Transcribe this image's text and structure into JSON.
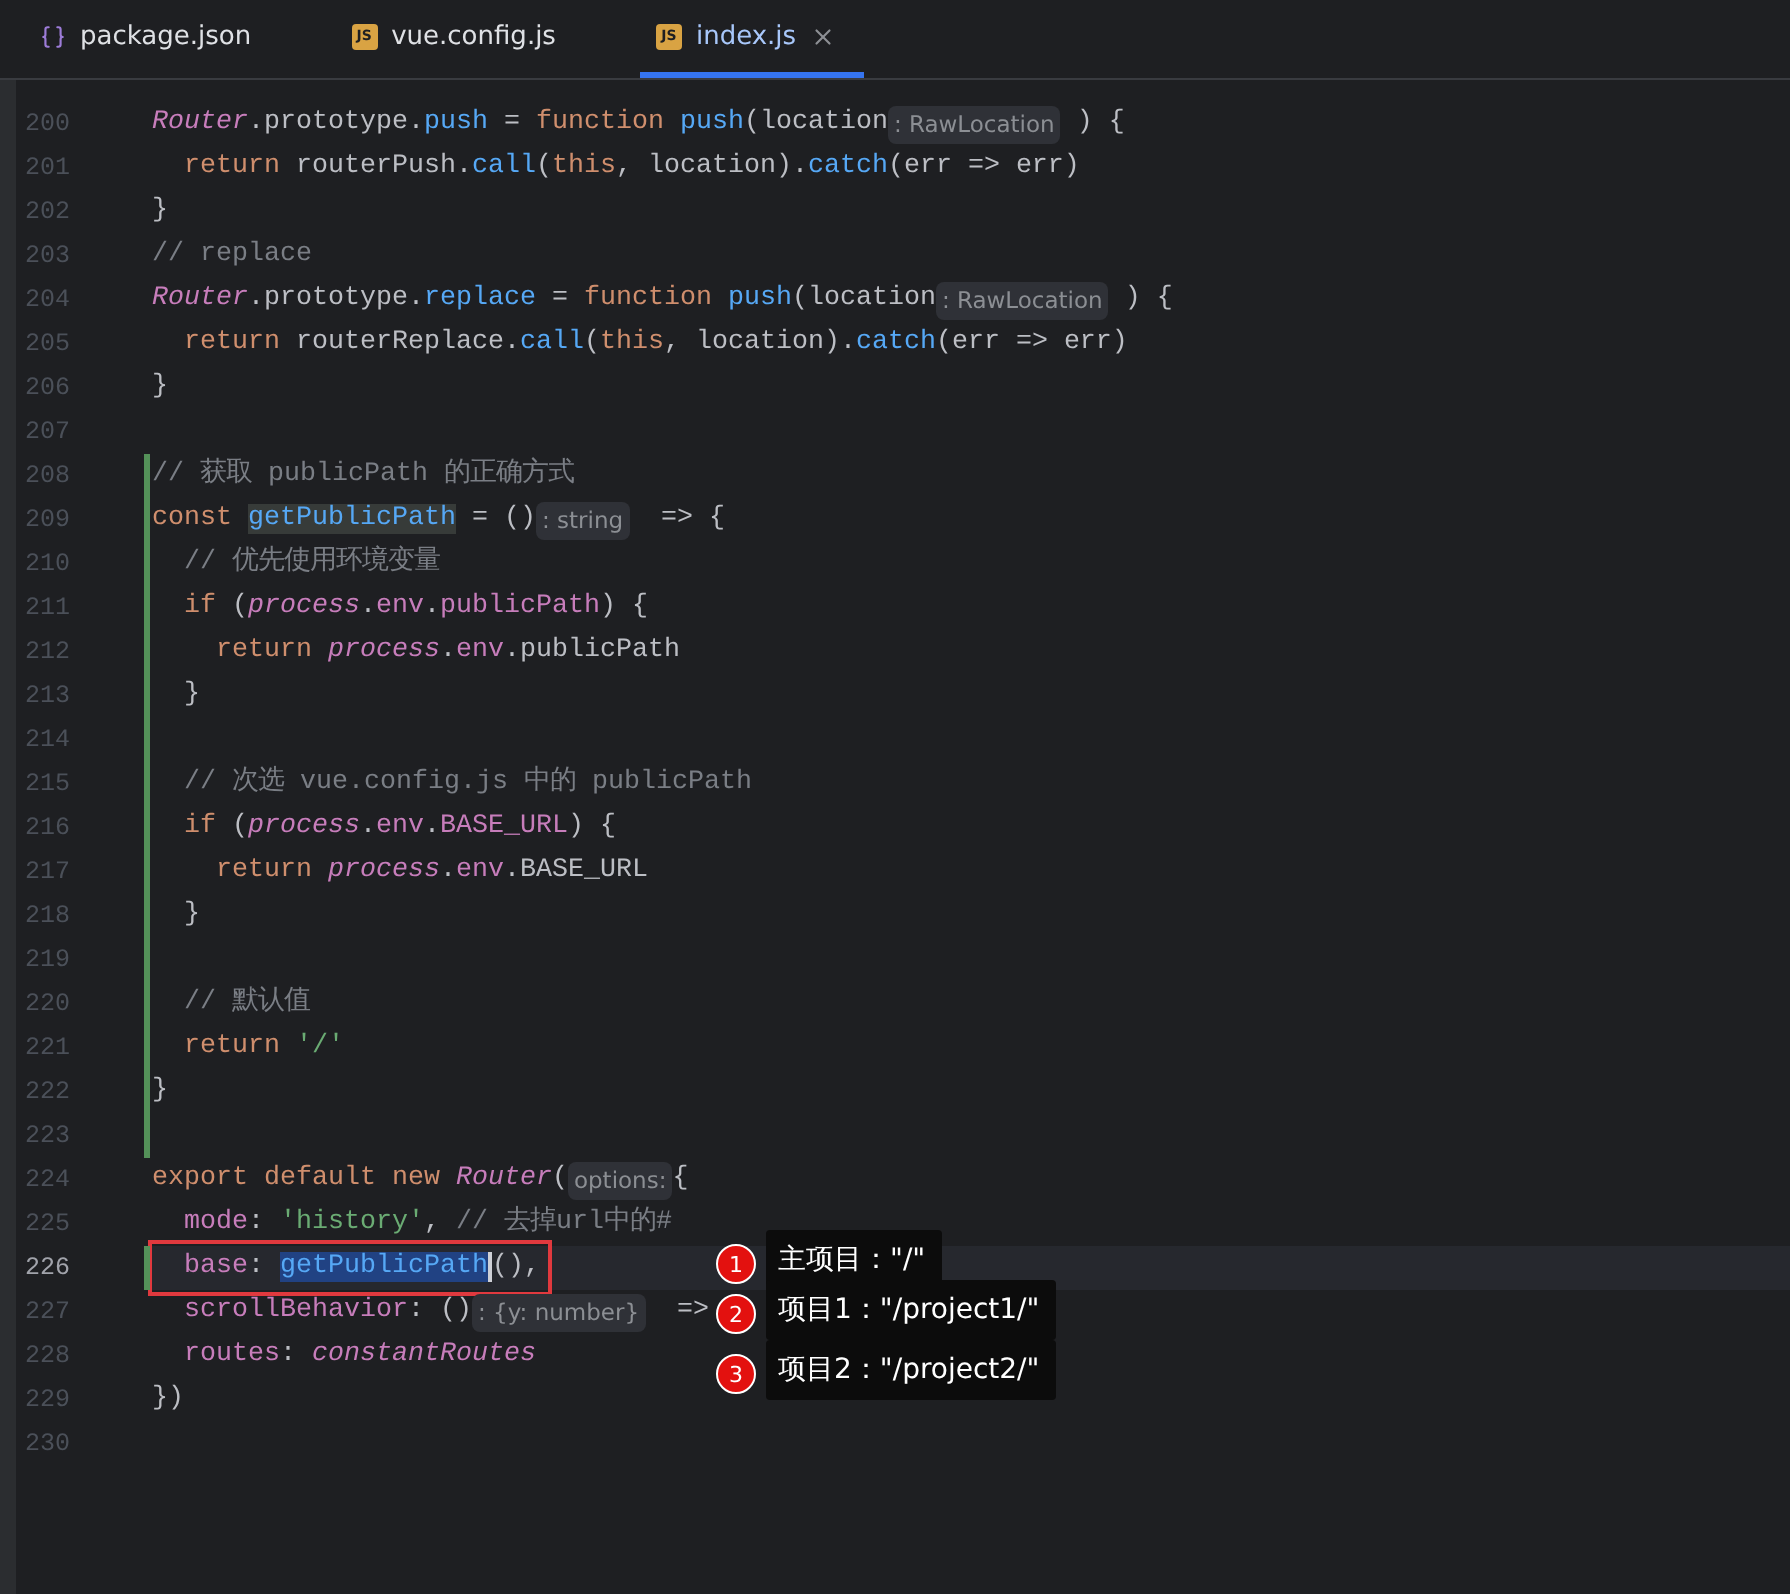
{
  "tabs": [
    {
      "label": "package.json",
      "kind": "json",
      "selected": false,
      "closable": false
    },
    {
      "label": "vue.config.js",
      "kind": "js",
      "icon_text": "JS",
      "selected": false,
      "closable": false
    },
    {
      "label": "index.js",
      "kind": "js",
      "icon_text": "JS",
      "selected": true,
      "closable": true
    }
  ],
  "lines": [
    {
      "number": "200",
      "changed": false,
      "current": false,
      "boxed": false,
      "segments": [
        {
          "kind": "class",
          "text": "Router"
        },
        {
          "kind": "plain",
          "text": ".prototype."
        },
        {
          "kind": "method",
          "text": "push"
        },
        {
          "kind": "plain",
          "text": " = "
        },
        {
          "kind": "keyword",
          "text": "function "
        },
        {
          "kind": "method",
          "text": "push"
        },
        {
          "kind": "plain",
          "text": "(location"
        },
        {
          "kind": "hint",
          "text": ": RawLocation"
        },
        {
          "kind": "plain",
          "text": " ) {"
        }
      ]
    },
    {
      "number": "201",
      "changed": false,
      "current": false,
      "boxed": false,
      "segments": [
        {
          "kind": "keyword",
          "text": "  return "
        },
        {
          "kind": "plain",
          "text": "routerPush."
        },
        {
          "kind": "method",
          "text": "call"
        },
        {
          "kind": "plain",
          "text": "("
        },
        {
          "kind": "keyword",
          "text": "this"
        },
        {
          "kind": "plain",
          "text": ", location)."
        },
        {
          "kind": "method",
          "text": "catch"
        },
        {
          "kind": "plain",
          "text": "(err => err)"
        }
      ]
    },
    {
      "number": "202",
      "changed": false,
      "current": false,
      "boxed": false,
      "segments": [
        {
          "kind": "plain",
          "text": "}"
        }
      ]
    },
    {
      "number": "203",
      "changed": false,
      "current": false,
      "boxed": false,
      "segments": [
        {
          "kind": "comment",
          "text": "// replace"
        }
      ]
    },
    {
      "number": "204",
      "changed": false,
      "current": false,
      "boxed": false,
      "segments": [
        {
          "kind": "class",
          "text": "Router"
        },
        {
          "kind": "plain",
          "text": ".prototype."
        },
        {
          "kind": "method",
          "text": "replace"
        },
        {
          "kind": "plain",
          "text": " = "
        },
        {
          "kind": "keyword",
          "text": "function "
        },
        {
          "kind": "method",
          "text": "push"
        },
        {
          "kind": "plain",
          "text": "(location"
        },
        {
          "kind": "hint",
          "text": ": RawLocation"
        },
        {
          "kind": "plain",
          "text": " ) {"
        }
      ]
    },
    {
      "number": "205",
      "changed": false,
      "current": false,
      "boxed": false,
      "segments": [
        {
          "kind": "keyword",
          "text": "  return "
        },
        {
          "kind": "plain",
          "text": "routerReplace."
        },
        {
          "kind": "method",
          "text": "call"
        },
        {
          "kind": "plain",
          "text": "("
        },
        {
          "kind": "keyword",
          "text": "this"
        },
        {
          "kind": "plain",
          "text": ", location)."
        },
        {
          "kind": "method",
          "text": "catch"
        },
        {
          "kind": "plain",
          "text": "(err => err)"
        }
      ]
    },
    {
      "number": "206",
      "changed": false,
      "current": false,
      "boxed": false,
      "segments": [
        {
          "kind": "plain",
          "text": "}"
        }
      ]
    },
    {
      "number": "207",
      "changed": false,
      "current": false,
      "boxed": false
    },
    {
      "number": "208",
      "changed": true,
      "current": false,
      "boxed": false,
      "segments": [
        {
          "kind": "comment",
          "text": "// 获取 publicPath 的正确方式"
        }
      ]
    },
    {
      "number": "209",
      "changed": true,
      "current": false,
      "boxed": false,
      "segments": [
        {
          "kind": "keyword",
          "text": "const "
        },
        {
          "kind": "usage",
          "text": "getPublicPath"
        },
        {
          "kind": "plain",
          "text": " = ()"
        },
        {
          "kind": "hint",
          "text": ": string"
        },
        {
          "kind": "plain",
          "text": "  => {"
        }
      ]
    },
    {
      "number": "210",
      "changed": true,
      "current": false,
      "boxed": false,
      "segments": [
        {
          "kind": "comment",
          "text": "  // 优先使用环境变量"
        }
      ]
    },
    {
      "number": "211",
      "changed": true,
      "current": false,
      "boxed": false,
      "segments": [
        {
          "kind": "keyword",
          "text": "  if "
        },
        {
          "kind": "plain",
          "text": "("
        },
        {
          "kind": "class",
          "text": "process"
        },
        {
          "kind": "plain",
          "text": "."
        },
        {
          "kind": "prop",
          "text": "env"
        },
        {
          "kind": "plain",
          "text": "."
        },
        {
          "kind": "prop",
          "text": "publicPath"
        },
        {
          "kind": "plain",
          "text": ") {"
        }
      ]
    },
    {
      "number": "212",
      "changed": true,
      "current": false,
      "boxed": false,
      "segments": [
        {
          "kind": "keyword",
          "text": "    return "
        },
        {
          "kind": "class",
          "text": "process"
        },
        {
          "kind": "plain",
          "text": "."
        },
        {
          "kind": "prop",
          "text": "env"
        },
        {
          "kind": "plain",
          "text": ".publicPath"
        }
      ]
    },
    {
      "number": "213",
      "changed": true,
      "current": false,
      "boxed": false,
      "segments": [
        {
          "kind": "plain",
          "text": "  }"
        }
      ]
    },
    {
      "number": "214",
      "changed": true,
      "current": false,
      "boxed": false
    },
    {
      "number": "215",
      "changed": true,
      "current": false,
      "boxed": false,
      "segments": [
        {
          "kind": "comment",
          "text": "  // 次选 vue.config.js 中的 publicPath"
        }
      ]
    },
    {
      "number": "216",
      "changed": true,
      "current": false,
      "boxed": false,
      "segments": [
        {
          "kind": "keyword",
          "text": "  if "
        },
        {
          "kind": "plain",
          "text": "("
        },
        {
          "kind": "class",
          "text": "process"
        },
        {
          "kind": "plain",
          "text": "."
        },
        {
          "kind": "prop",
          "text": "env"
        },
        {
          "kind": "plain",
          "text": "."
        },
        {
          "kind": "prop",
          "text": "BASE_URL"
        },
        {
          "kind": "plain",
          "text": ") {"
        }
      ]
    },
    {
      "number": "217",
      "changed": true,
      "current": false,
      "boxed": false,
      "segments": [
        {
          "kind": "keyword",
          "text": "    return "
        },
        {
          "kind": "class",
          "text": "process"
        },
        {
          "kind": "plain",
          "text": "."
        },
        {
          "kind": "prop",
          "text": "env"
        },
        {
          "kind": "plain",
          "text": ".BASE_URL"
        }
      ]
    },
    {
      "number": "218",
      "changed": true,
      "current": false,
      "boxed": false,
      "segments": [
        {
          "kind": "plain",
          "text": "  }"
        }
      ]
    },
    {
      "number": "219",
      "changed": true,
      "current": false,
      "boxed": false
    },
    {
      "number": "220",
      "changed": true,
      "current": false,
      "boxed": false,
      "segments": [
        {
          "kind": "comment",
          "text": "  // 默认值"
        }
      ]
    },
    {
      "number": "221",
      "changed": true,
      "current": false,
      "boxed": false,
      "segments": [
        {
          "kind": "keyword",
          "text": "  return "
        },
        {
          "kind": "string",
          "text": "'/'"
        }
      ]
    },
    {
      "number": "222",
      "changed": true,
      "current": false,
      "boxed": false,
      "segments": [
        {
          "kind": "plain",
          "text": "}"
        }
      ]
    },
    {
      "number": "223",
      "changed": true,
      "current": false,
      "boxed": false
    },
    {
      "number": "224",
      "changed": false,
      "current": false,
      "boxed": false,
      "segments": [
        {
          "kind": "keyword",
          "text": "export default new "
        },
        {
          "kind": "class",
          "text": "Router"
        },
        {
          "kind": "plain",
          "text": "("
        },
        {
          "kind": "hint",
          "text": "options:"
        },
        {
          "kind": "plain",
          "text": "{"
        }
      ]
    },
    {
      "number": "225",
      "changed": false,
      "current": false,
      "boxed": false,
      "segments": [
        {
          "kind": "prop",
          "text": "  mode"
        },
        {
          "kind": "plain",
          "text": ": "
        },
        {
          "kind": "string",
          "text": "'history'"
        },
        {
          "kind": "plain",
          "text": ", "
        },
        {
          "kind": "comment",
          "text": "// 去掉url中的#"
        }
      ]
    },
    {
      "number": "226",
      "changed": true,
      "current": true,
      "boxed": true,
      "segments": [
        {
          "kind": "prop",
          "text": "  base"
        },
        {
          "kind": "plain",
          "text": ": "
        },
        {
          "kind": "selected",
          "text": "getPublicPath"
        },
        {
          "kind": "plain",
          "text": "(),"
        }
      ]
    },
    {
      "number": "227",
      "changed": false,
      "current": false,
      "boxed": false,
      "segments": [
        {
          "kind": "prop",
          "text": "  scrollBehavior"
        },
        {
          "kind": "plain",
          "text": ": ()"
        },
        {
          "kind": "hint",
          "text": ": {y: number}"
        },
        {
          "kind": "plain",
          "text": "  =>"
        }
      ]
    },
    {
      "number": "228",
      "changed": false,
      "current": false,
      "boxed": false,
      "segments": [
        {
          "kind": "prop",
          "text": "  routes"
        },
        {
          "kind": "plain",
          "text": ": "
        },
        {
          "kind": "class",
          "text": "constantRoutes"
        }
      ]
    },
    {
      "number": "229",
      "changed": false,
      "current": false,
      "boxed": false,
      "segments": [
        {
          "kind": "plain",
          "text": "})"
        }
      ]
    },
    {
      "number": "230",
      "changed": false,
      "current": false,
      "boxed": false
    }
  ],
  "callouts": [
    {
      "badge": "1",
      "text": "主项目：\"/\""
    },
    {
      "badge": "2",
      "text": "项目1：\"/project1/\""
    },
    {
      "badge": "3",
      "text": "项目2：\"/project2/\""
    }
  ]
}
